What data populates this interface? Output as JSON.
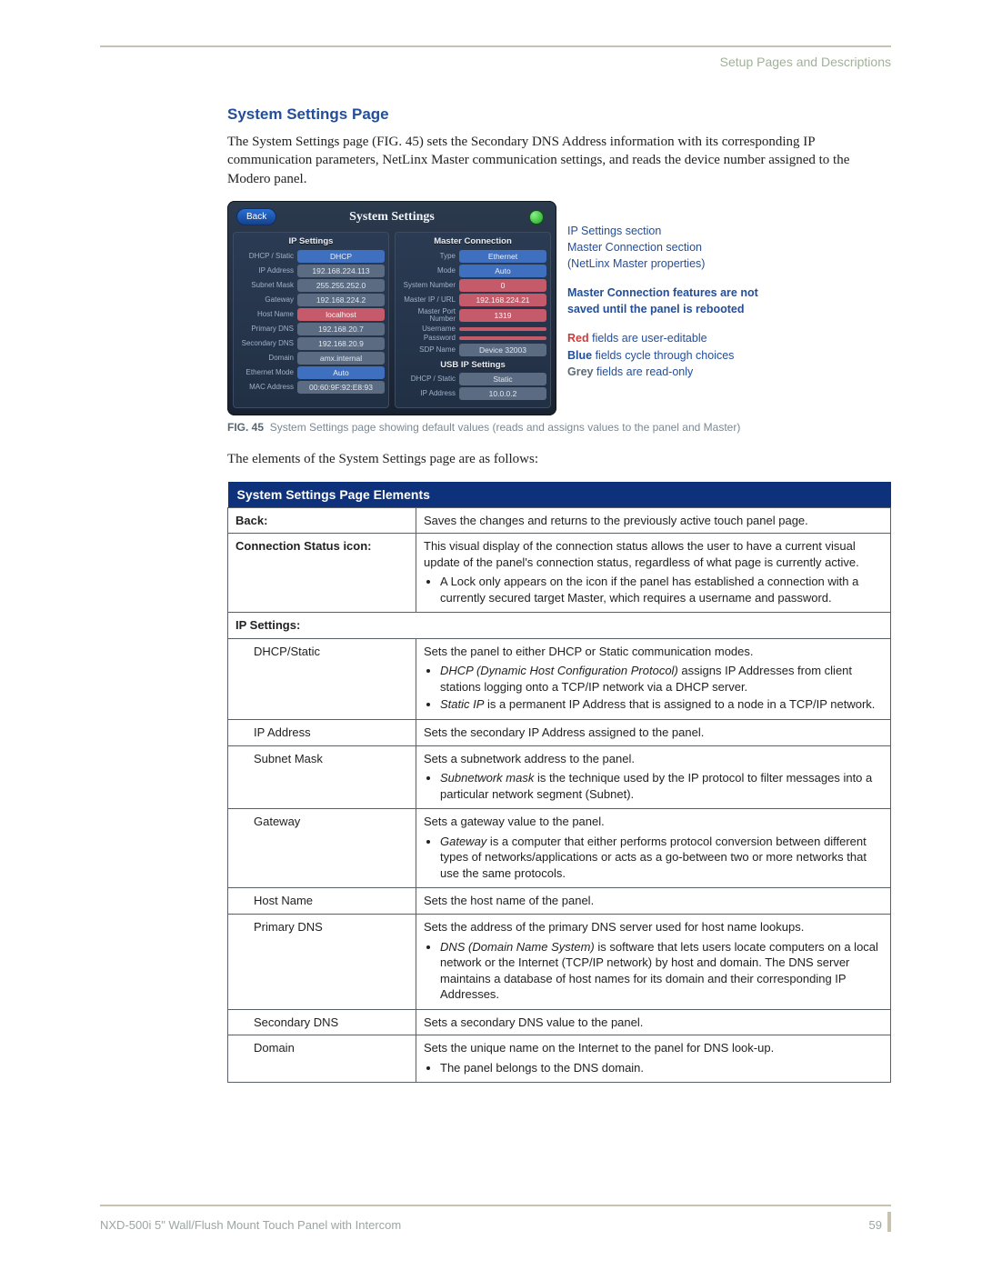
{
  "breadcrumb": "Setup Pages and Descriptions",
  "section_title": "System Settings Page",
  "intro": "The System Settings page (FIG. 45) sets the Secondary DNS Address information with its corresponding IP communication parameters, NetLinx Master communication settings, and reads the device number assigned to the Modero panel.",
  "panel": {
    "title": "System Settings",
    "back": "Back",
    "ip_head": "IP Settings",
    "mc_head": "Master Connection",
    "usb_head": "USB IP Settings",
    "left": [
      {
        "label": "DHCP / Static",
        "value": "DHCP",
        "cls": "blue"
      },
      {
        "label": "IP Address",
        "value": "192.168.224.113",
        "cls": "grey"
      },
      {
        "label": "Subnet Mask",
        "value": "255.255.252.0",
        "cls": "grey"
      },
      {
        "label": "Gateway",
        "value": "192.168.224.2",
        "cls": "grey"
      },
      {
        "label": "Host Name",
        "value": "localhost",
        "cls": "red"
      },
      {
        "label": "Primary DNS",
        "value": "192.168.20.7",
        "cls": "grey"
      },
      {
        "label": "Secondary DNS",
        "value": "192.168.20.9",
        "cls": "grey"
      },
      {
        "label": "Domain",
        "value": "amx.internal",
        "cls": "grey"
      },
      {
        "label": "Ethernet Mode",
        "value": "Auto",
        "cls": "blue"
      },
      {
        "label": "MAC Address",
        "value": "00:60:9F:92:E8:93",
        "cls": "grey"
      }
    ],
    "right": [
      {
        "label": "Type",
        "value": "Ethernet",
        "cls": "blue"
      },
      {
        "label": "Mode",
        "value": "Auto",
        "cls": "blue"
      },
      {
        "label": "System Number",
        "value": "0",
        "cls": "red"
      },
      {
        "label": "Master IP / URL",
        "value": "192.168.224.21",
        "cls": "red"
      },
      {
        "label": "Master Port Number",
        "value": "1319",
        "cls": "red"
      },
      {
        "label": "Username",
        "value": "",
        "cls": "red"
      },
      {
        "label": "Password",
        "value": "",
        "cls": "red"
      },
      {
        "label": "SDP Name",
        "value": "Device 32003",
        "cls": "grey"
      }
    ],
    "usb": [
      {
        "label": "DHCP / Static",
        "value": "Static",
        "cls": "grey"
      },
      {
        "label": "IP Address",
        "value": "10.0.0.2",
        "cls": "grey"
      }
    ]
  },
  "callouts": {
    "ip": "IP Settings section",
    "mc1": "Master Connection section",
    "mc2": "(NetLinx Master properties)",
    "warn1": "Master Connection features are not",
    "warn2": "saved until the panel is rebooted",
    "red_b": "Red",
    "red_t": " fields are user-editable",
    "blue_b": "Blue",
    "blue_t": " fields cycle through choices",
    "grey_b": "Grey",
    "grey_t": " fields are read-only"
  },
  "fig": {
    "num": "FIG. 45",
    "txt": "System Settings page showing default values (reads and assigns values to the panel and Master)"
  },
  "lead2": "The elements of the System Settings page are as follows:",
  "table": {
    "title": "System Settings Page Elements",
    "rows": [
      {
        "k": "Back:",
        "kcls": "k",
        "v": "Saves the changes and returns to the previously active touch panel page."
      },
      {
        "k": "Connection Status icon:",
        "kcls": "k",
        "v": "This visual display of the connection status allows the user to have a current visual update of the panel's connection status, regardless of what page is currently active.",
        "bullets": [
          "A Lock only appears on the icon if the panel has established a connection with a currently secured target Master, which requires a username and password."
        ]
      },
      {
        "k": "IP Settings:",
        "kcls": "k",
        "colspan": true
      },
      {
        "k": "DHCP/Static",
        "kcls": "k indent",
        "v": "Sets the panel to either DHCP or Static communication modes.",
        "bullets": [
          "<span class='ital'>DHCP (Dynamic Host Configuration Protocol)</span> assigns IP Addresses from client stations logging onto a TCP/IP network via a DHCP server.",
          "<span class='ital'>Static IP</span> is a permanent IP Address that is assigned to a node in a TCP/IP network."
        ]
      },
      {
        "k": "IP Address",
        "kcls": "k indent",
        "v": "Sets the secondary IP Address assigned to the panel."
      },
      {
        "k": "Subnet Mask",
        "kcls": "k indent",
        "v": "Sets a subnetwork address to the panel.",
        "bullets": [
          "<span class='ital'>Subnetwork mask</span> is the technique used by the IP protocol to filter messages into a particular network segment (Subnet)."
        ]
      },
      {
        "k": "Gateway",
        "kcls": "k indent",
        "v": "Sets a gateway value to the panel.",
        "bullets": [
          "<span class='ital'>Gateway</span> is a computer that either performs protocol conversion between different types of networks/applications or acts as a go-between two or more networks that use the same protocols."
        ]
      },
      {
        "k": "Host Name",
        "kcls": "k indent",
        "v": "Sets the host name of the panel."
      },
      {
        "k": "Primary DNS",
        "kcls": "k indent",
        "v": "Sets the address of the primary DNS server used for host name lookups.",
        "bullets": [
          "<span class='ital'>DNS (Domain Name System)</span> is software that lets users locate computers on a local network or the Internet (TCP/IP network) by host and domain. The DNS server maintains a database of host names for its domain and their corresponding IP Addresses."
        ]
      },
      {
        "k": "Secondary DNS",
        "kcls": "k indent",
        "v": "Sets a secondary DNS value to the panel."
      },
      {
        "k": "Domain",
        "kcls": "k indent",
        "v": "Sets the unique name on the Internet to the panel for DNS look-up.",
        "bullets": [
          "The panel belongs to the DNS domain."
        ]
      }
    ]
  },
  "footer": {
    "product": "NXD-500i 5\" Wall/Flush Mount Touch Panel with Intercom",
    "page": "59"
  }
}
